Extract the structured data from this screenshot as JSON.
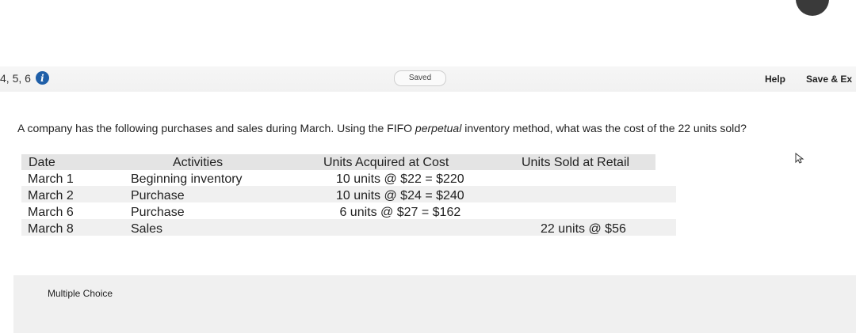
{
  "header": {
    "breadcrumb": "4, 5, 6",
    "info_glyph": "i",
    "saved_label": "Saved",
    "help_label": "Help",
    "save_exit_label": "Save & Ex"
  },
  "question": {
    "prefix": "A company has the following purchases and sales during March. Using the FIFO ",
    "emphasis": "perpetual",
    "suffix": " inventory method, what was the cost of the 22 units sold?"
  },
  "table": {
    "headers": [
      "Date",
      "Activities",
      "Units Acquired at Cost",
      "Units Sold at Retail"
    ],
    "rows": [
      [
        "March 1",
        "Beginning inventory",
        "10 units @ $22 = $220",
        ""
      ],
      [
        "March 2",
        "Purchase",
        "10 units @ $24 = $240",
        ""
      ],
      [
        "March 6",
        "Purchase",
        " 6 units @ $27 = $162",
        ""
      ],
      [
        "March 8",
        "Sales",
        "",
        "22 units @ $56"
      ]
    ]
  },
  "answer": {
    "label": "Multiple Choice"
  },
  "icons": {
    "info": "info-icon",
    "cursor": "cursor-icon"
  },
  "colors": {
    "info_icon": "#1f5fa8",
    "header_bg": "#e4e4e4"
  }
}
